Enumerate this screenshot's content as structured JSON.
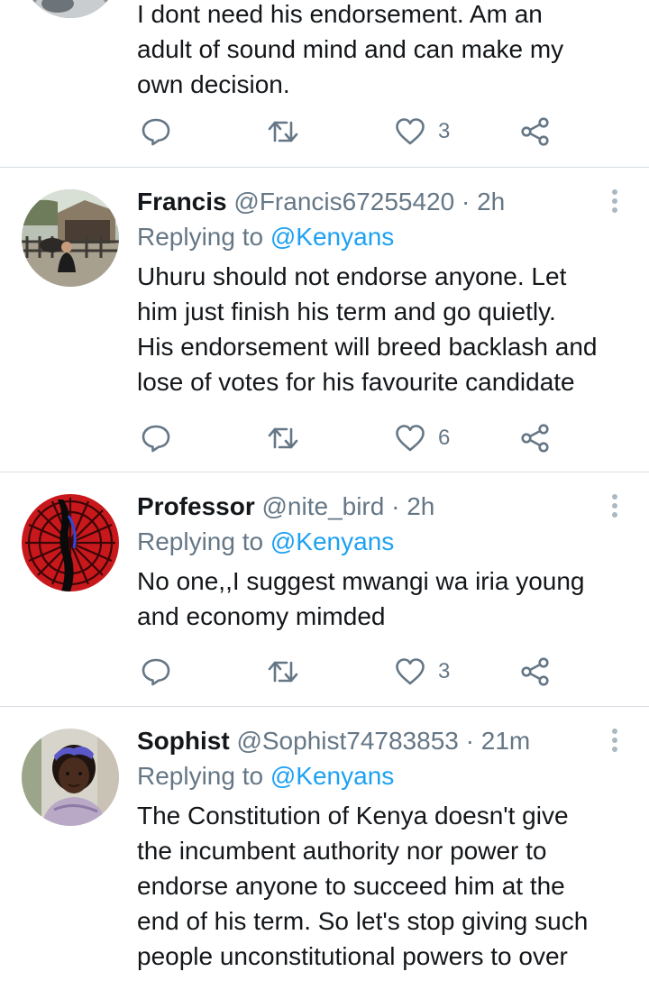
{
  "tweets": [
    {
      "body": "I dont need his endorsement. Am an\nadult of sound mind and can make my\nown decision.",
      "likes": "3",
      "avatar_icon": "user-avatar"
    },
    {
      "name": "Francis",
      "handle": "@Francis67255420",
      "separator": "·",
      "time": "2h",
      "replying_prefix": "Replying to",
      "replying_to": "@Kenyans",
      "body": "Uhuru should not endorse anyone. Let\nhim just finish his term and go quietly.\nHis endorsement will breed backlash and\nlose of votes for his favourite candidate",
      "likes": "6",
      "avatar_icon": "user-avatar"
    },
    {
      "name": "Professor",
      "handle": "@nite_bird",
      "separator": "·",
      "time": "2h",
      "replying_prefix": "Replying to",
      "replying_to": "@Kenyans",
      "body": "No one,,I suggest mwangi wa iria young\nand economy mimded",
      "likes": "3",
      "avatar_icon": "user-avatar"
    },
    {
      "name": "Sophist",
      "handle": "@Sophist74783853",
      "separator": "·",
      "time": "21m",
      "replying_prefix": "Replying to",
      "replying_to": "@Kenyans",
      "body": "The Constitution of Kenya doesn't give\nthe incumbent authority nor power to\nendorse anyone to succeed him at the\nend of his term. So let's stop giving such\npeople unconstitutional powers to over",
      "avatar_icon": "user-avatar"
    }
  ],
  "icons": {
    "reply": "reply-icon",
    "retweet": "retweet-icon",
    "like": "heart-icon",
    "share": "share-icon",
    "more": "more-options-icon"
  },
  "colors": {
    "accent": "#1da1f2",
    "secondary_text": "#657786",
    "primary_text": "#14171a",
    "divider": "#d6dde3"
  }
}
